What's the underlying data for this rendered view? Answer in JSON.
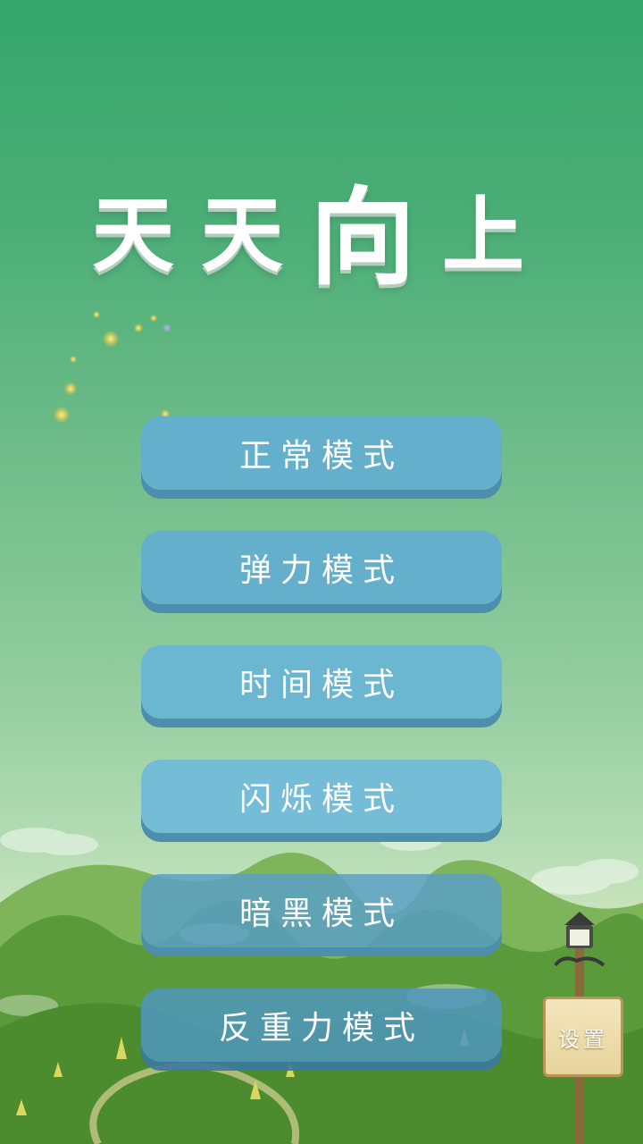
{
  "title": {
    "chars": [
      "天",
      "天",
      "向",
      "上"
    ]
  },
  "menu": {
    "buttons": [
      {
        "label": "正常模式"
      },
      {
        "label": "弹力模式"
      },
      {
        "label": "时间模式"
      },
      {
        "label": "闪烁模式"
      },
      {
        "label": "暗黑模式"
      },
      {
        "label": "反重力模式"
      }
    ]
  },
  "settings": {
    "label": "设置"
  },
  "colors": {
    "sky_top": "#35a66c",
    "button": "#64b0cc",
    "button_shadow": "#4d8ead",
    "hill": "#5b9a3a"
  }
}
